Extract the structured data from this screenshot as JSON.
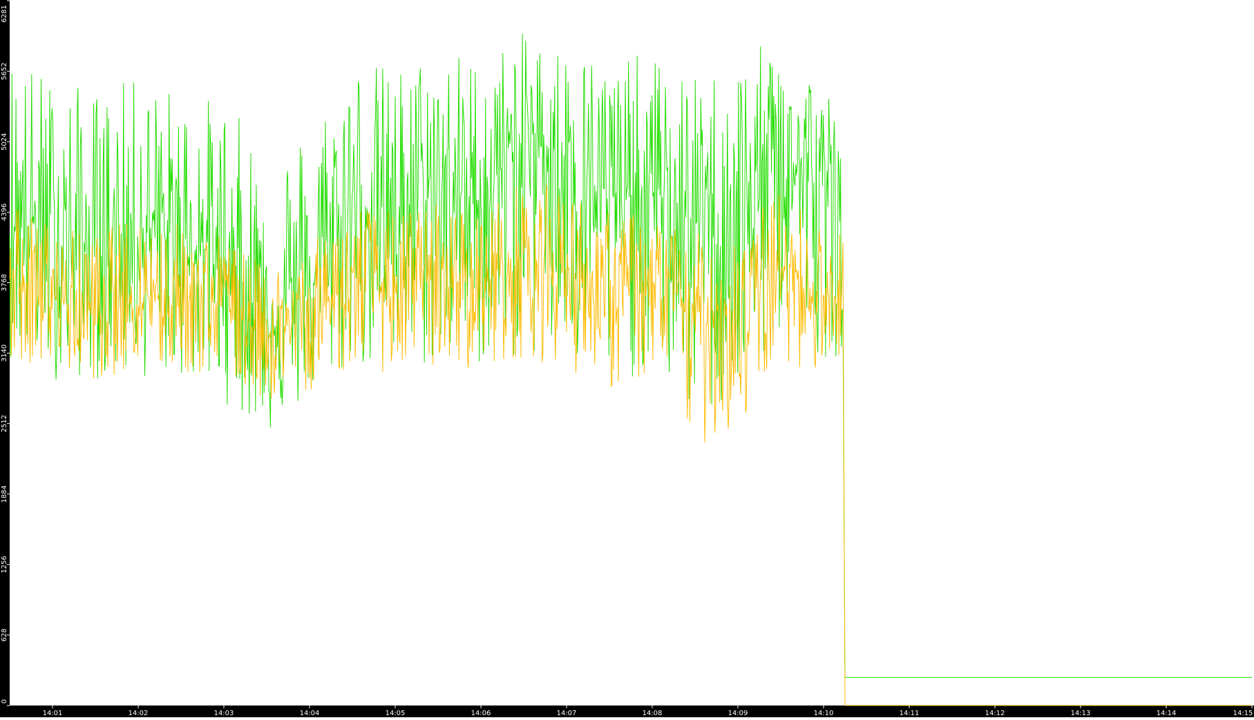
{
  "chart_data": {
    "type": "line",
    "title": "",
    "xlabel": "",
    "ylabel": "",
    "y_ticks": [
      0,
      628,
      1256,
      1884,
      2512,
      3140,
      3768,
      4396,
      5024,
      5652,
      6281
    ],
    "y_tick_labels": [
      "0",
      "628",
      "1256",
      "1884",
      "2512",
      "3140",
      "3768",
      "4396",
      "5024",
      "5652",
      "6281"
    ],
    "ylim": [
      0,
      6281
    ],
    "x_ticks": [
      "14:01",
      "14:02",
      "14:03",
      "14:04",
      "14:05",
      "14:06",
      "14:07",
      "14:08",
      "14:09",
      "14:10",
      "14:11",
      "14:12",
      "14:13",
      "14:14",
      "14:15"
    ],
    "x_range": [
      "14:00:30",
      "14:15:00"
    ],
    "grid": false,
    "legend": "none",
    "colors": {
      "axis_bg": "#000000",
      "axis_text": "#ffffff",
      "plot_bg": "#ffffff",
      "series_green": "#22dd00",
      "series_orange": "#ffbb00"
    },
    "series": [
      {
        "color": "#22dd00",
        "x": [
          "14:00:30",
          "14:01:00",
          "14:01:30",
          "14:02:00",
          "14:02:30",
          "14:03:00",
          "14:03:30",
          "14:04:00",
          "14:04:30",
          "14:05:00",
          "14:05:30",
          "14:06:00",
          "14:06:30",
          "14:07:00",
          "14:07:30",
          "14:08:00",
          "14:08:30",
          "14:09:00",
          "14:09:30",
          "14:10:00",
          "14:10:14",
          "14:10:15",
          "14:15:00"
        ],
        "values": [
          4400,
          4200,
          4000,
          4250,
          4150,
          4000,
          3500,
          3700,
          4500,
          4400,
          4600,
          4500,
          5100,
          4900,
          4500,
          4600,
          4300,
          4400,
          4900,
          4600,
          4400,
          250,
          250
        ],
        "upper": [
          5900,
          5600,
          5500,
          5600,
          5500,
          5400,
          5000,
          5200,
          5800,
          5700,
          5900,
          5800,
          6000,
          5900,
          5800,
          5800,
          5600,
          5800,
          5950,
          5600,
          5200,
          250,
          250
        ],
        "lower": [
          3100,
          2900,
          2900,
          2900,
          2900,
          2700,
          2400,
          2700,
          3000,
          2900,
          3000,
          3000,
          3100,
          2900,
          2800,
          3000,
          2500,
          2600,
          3300,
          3100,
          3100,
          250,
          250
        ]
      },
      {
        "color": "#ffbb00",
        "x": [
          "14:00:30",
          "14:01:00",
          "14:01:30",
          "14:02:00",
          "14:02:30",
          "14:03:00",
          "14:03:30",
          "14:04:00",
          "14:04:30",
          "14:05:00",
          "14:05:30",
          "14:06:00",
          "14:06:30",
          "14:07:00",
          "14:07:30",
          "14:08:00",
          "14:08:30",
          "14:09:00",
          "14:09:30",
          "14:10:00",
          "14:10:14",
          "14:10:15",
          "14:15:00"
        ],
        "values": [
          3800,
          3650,
          3500,
          3700,
          3650,
          3600,
          3300,
          3450,
          3800,
          3700,
          3800,
          3750,
          4000,
          3900,
          3700,
          3750,
          3500,
          3550,
          3900,
          3700,
          3600,
          0,
          0
        ],
        "upper": [
          4500,
          4300,
          4200,
          4400,
          4300,
          4200,
          3900,
          4100,
          4500,
          4400,
          4500,
          4400,
          4700,
          4600,
          4400,
          4400,
          4200,
          4300,
          4600,
          4300,
          4200,
          0,
          0
        ],
        "lower": [
          3100,
          3000,
          2900,
          3000,
          2950,
          2900,
          2700,
          2800,
          3000,
          2950,
          3000,
          3000,
          3100,
          3000,
          2800,
          2900,
          2300,
          2400,
          3100,
          2900,
          2800,
          0,
          0
        ]
      }
    ]
  }
}
